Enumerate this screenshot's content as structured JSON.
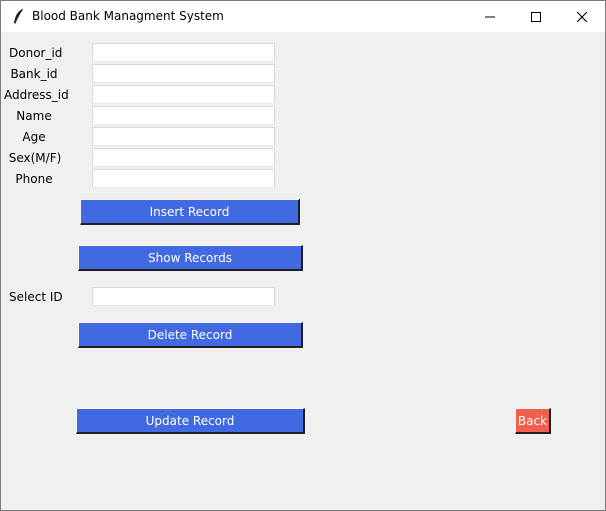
{
  "window": {
    "title": "Blood Bank Managment System",
    "icon": "feather-icon",
    "controls": {
      "minimize_icon": "minimize-icon",
      "maximize_icon": "maximize-icon",
      "close_icon": "close-icon"
    }
  },
  "form": {
    "fields": [
      {
        "label": "Donor_id",
        "value": ""
      },
      {
        "label": "Bank_id",
        "value": ""
      },
      {
        "label": "Address_id",
        "value": ""
      },
      {
        "label": "Name",
        "value": ""
      },
      {
        "label": "Age",
        "value": ""
      },
      {
        "label": "Sex(M/F)",
        "value": ""
      },
      {
        "label": "Phone",
        "value": ""
      }
    ],
    "select_id": {
      "label": "Select ID",
      "value": ""
    }
  },
  "buttons": {
    "insert": "Insert Record",
    "show": "Show Records",
    "delete": "Delete Record",
    "update": "Update Record",
    "back": "Back"
  },
  "colors": {
    "primary_button": "#4169e1",
    "back_button": "#f0604f",
    "background": "#f0f0f0"
  }
}
